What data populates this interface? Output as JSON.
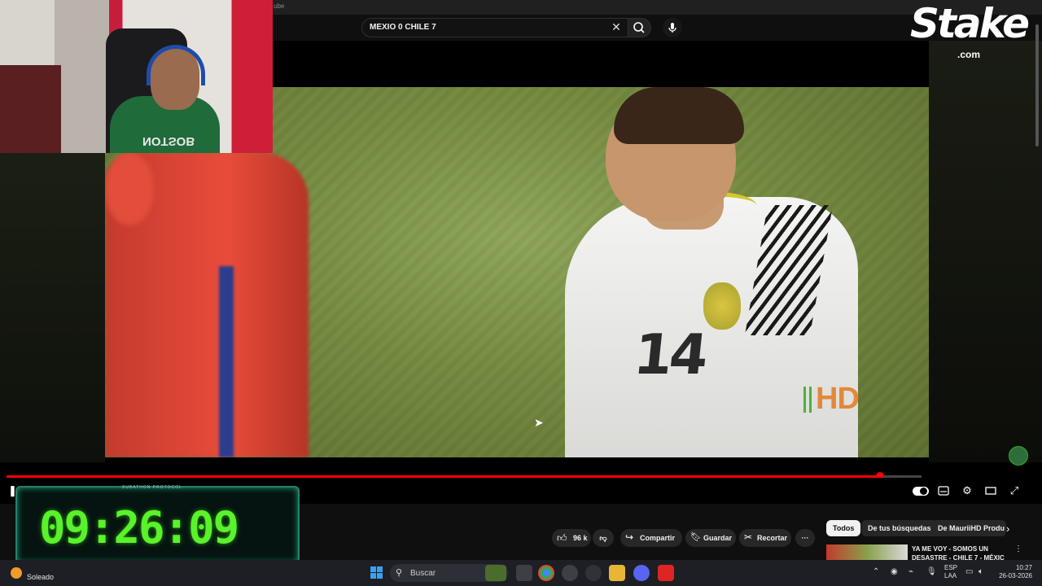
{
  "browser": {
    "tab_text": "ube"
  },
  "search": {
    "query": "MEXIO 0 CHILE 7",
    "clear_icon": "close-icon",
    "search_icon": "search-icon",
    "mic_icon": "mic-icon"
  },
  "overlay": {
    "brand": "Stake",
    "brand_domain": ".com",
    "timer_title": "SUBATHON PROTOCOL",
    "timer_value": "09:26:09"
  },
  "video": {
    "watermark": "HD",
    "jersey_number": "14",
    "webcam_shirt_text": "NOTSOB",
    "progress_fraction": 0.955
  },
  "actions": {
    "likes": "96 k",
    "share": "Compartir",
    "save": "Guardar",
    "clip": "Recortar",
    "more": "···"
  },
  "chips": [
    "Todos",
    "De tus búsquedas",
    "De MauriiHD Produ"
  ],
  "recommendation": {
    "title": "YA ME VOY - SOMOS UN DESASTRE - CHILE 7 - MÉXIC"
  },
  "taskbar": {
    "weather": "Soleado",
    "search": "Buscar",
    "lang_1": "ESP",
    "lang_2": "LAA",
    "time": "10:27",
    "date": "26-03-2026"
  },
  "colors": {
    "progress": "#ff0000",
    "timer": "#5af22a",
    "youtube_bg": "#0f0f0f"
  }
}
